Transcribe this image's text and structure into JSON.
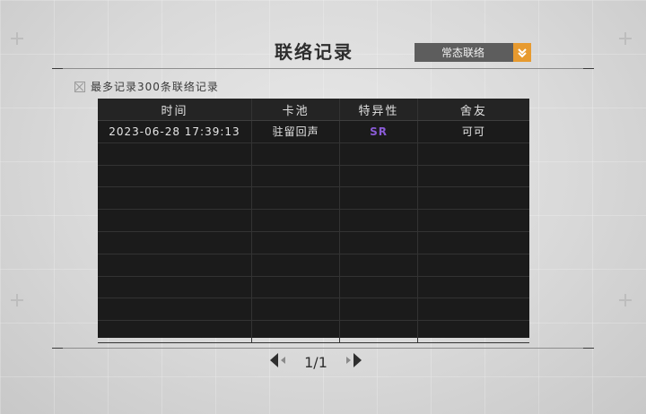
{
  "title": "联络记录",
  "pool_select": {
    "value": "常态联络",
    "accent": "#e79a2f"
  },
  "note": "最多记录300条联络记录",
  "table": {
    "headers": [
      "时间",
      "卡池",
      "特异性",
      "舍友"
    ],
    "rows": [
      [
        "2023-06-28 17:39:13",
        "驻留回声",
        "SR",
        "可可"
      ],
      [
        "",
        "",
        "",
        ""
      ],
      [
        "",
        "",
        "",
        ""
      ],
      [
        "",
        "",
        "",
        ""
      ],
      [
        "",
        "",
        "",
        ""
      ],
      [
        "",
        "",
        "",
        ""
      ],
      [
        "",
        "",
        "",
        ""
      ],
      [
        "",
        "",
        "",
        ""
      ],
      [
        "",
        "",
        "",
        ""
      ],
      [
        "",
        "",
        "",
        ""
      ]
    ]
  },
  "pager": {
    "current": "1/1"
  },
  "colors": {
    "sr": "#8a5bd6",
    "table_bg": "#1b1b1b"
  },
  "icons": [
    "dropdown-chevron-icon",
    "prev-page-icon",
    "next-page-icon",
    "checkbox-icon"
  ]
}
